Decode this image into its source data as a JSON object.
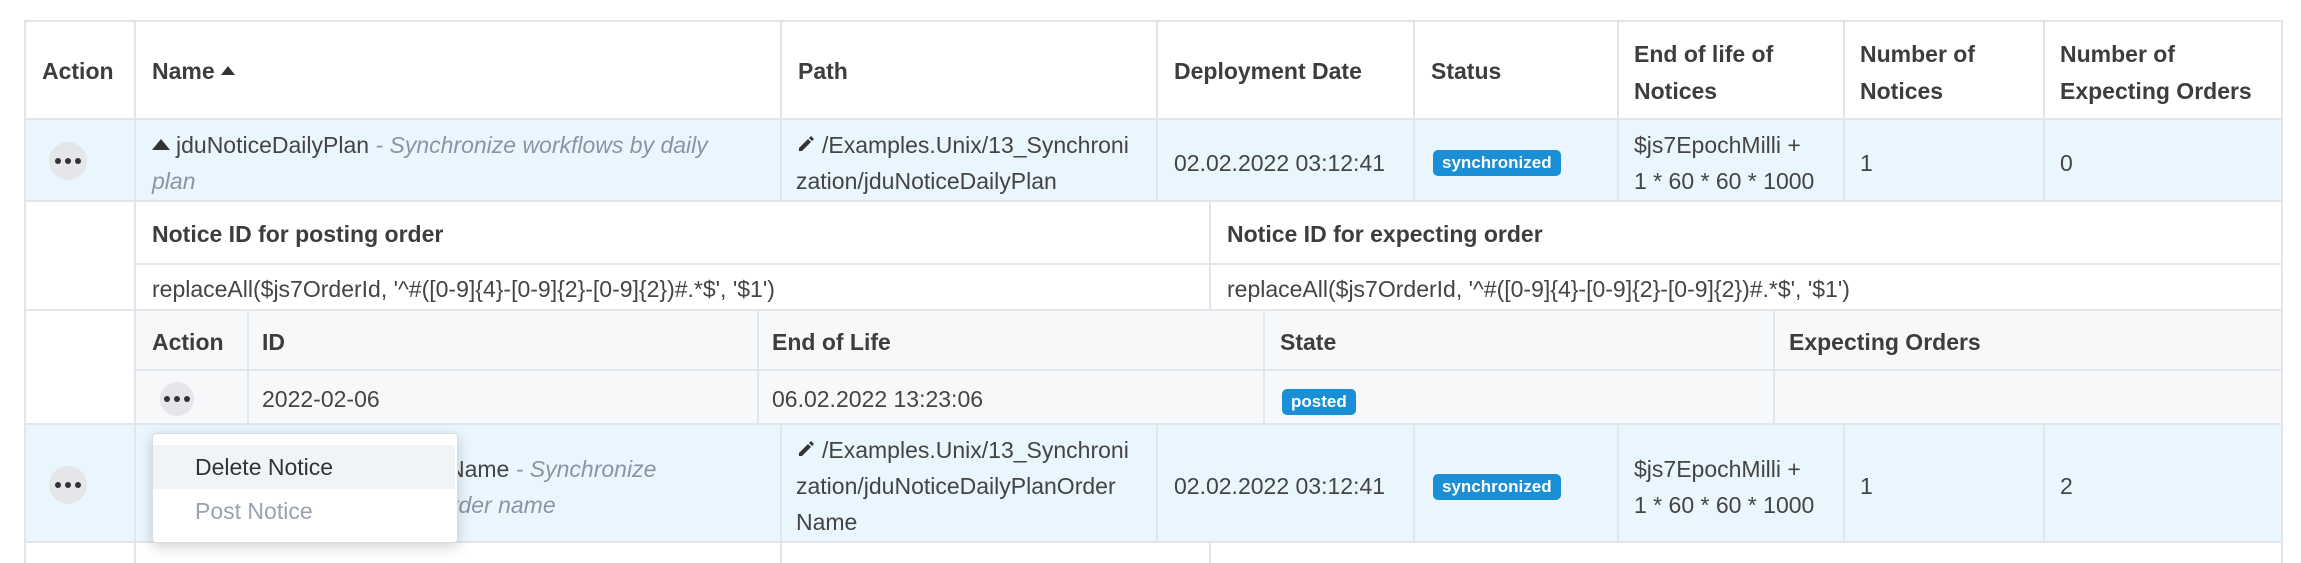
{
  "columns": {
    "action": "Action",
    "name": "Name",
    "path": "Path",
    "deployment_date": "Deployment Date",
    "status": "Status",
    "end_of_life_1": "End of life of",
    "end_of_life_2": "Notices",
    "number_notices_1": "Number of",
    "number_notices_2": "Notices",
    "number_expecting_1": "Number of",
    "number_expecting_2": "Expecting Orders"
  },
  "rows": [
    {
      "name": "jduNoticeDailyPlan",
      "desc_1": " - Synchronize workflows by daily",
      "desc_2": "plan",
      "path_1": "/Examples.Unix/13_Synchroni",
      "path_2": "zation/jduNoticeDailyPlan",
      "deployment_date": "02.02.2022 03:12:41",
      "status": "synchronized",
      "end_of_life_1": "$js7EpochMilli +",
      "end_of_life_2": "1 * 60 * 60 * 1000",
      "number_notices": "1",
      "number_expecting": "0"
    },
    {
      "name_partial": "Name",
      "desc_1": " - Synchronize",
      "desc_2": "order name",
      "path_1": "/Examples.Unix/13_Synchroni",
      "path_2": "zation/jduNoticeDailyPlanOrder",
      "path_3": "Name",
      "deployment_date": "02.02.2022 03:12:41",
      "status": "synchronized",
      "end_of_life_1": "$js7EpochMilli +",
      "end_of_life_2": "1 * 60 * 60 * 1000",
      "number_notices": "1",
      "number_expecting": "2"
    }
  ],
  "notice_ids": {
    "posting_header": "Notice ID for posting order",
    "expecting_header": "Notice ID for expecting order",
    "posting_value": "replaceAll($js7OrderId, '^#([0-9]{4}-[0-9]{2}-[0-9]{2})#.*$', '$1')",
    "expecting_value": "replaceAll($js7OrderId, '^#([0-9]{4}-[0-9]{2}-[0-9]{2})#.*$', '$1')"
  },
  "notices_table": {
    "headers": {
      "action": "Action",
      "id": "ID",
      "end_of_life": "End of Life",
      "state": "State",
      "expecting_orders": "Expecting Orders"
    },
    "rows": [
      {
        "id": "2022-02-06",
        "end_of_life": "06.02.2022 13:23:06",
        "state": "posted",
        "expecting_orders": ""
      }
    ]
  },
  "context_menu": {
    "items": [
      {
        "label": "Delete Notice",
        "enabled": true
      },
      {
        "label": "Post Notice",
        "enabled": false
      }
    ]
  },
  "colors": {
    "row_highlight": "#e9f6fd",
    "badge": "#1a8fd6",
    "border": "#e2e6ea",
    "muted_text": "#8a94a6"
  },
  "icons": [
    "sort-up-icon",
    "collapse-icon",
    "edit-icon",
    "more-actions-icon"
  ]
}
